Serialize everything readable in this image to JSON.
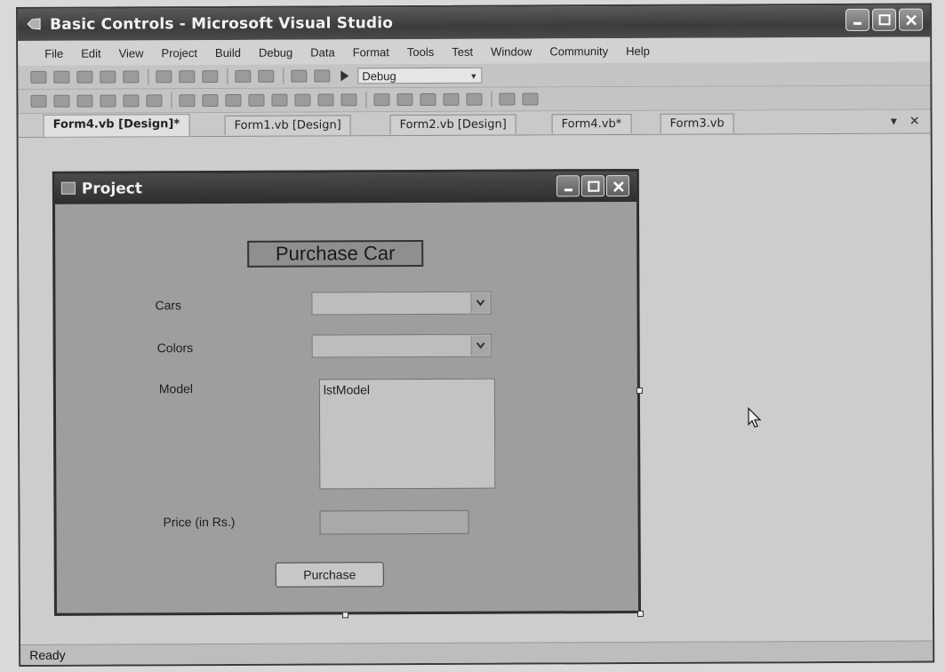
{
  "window": {
    "title": "Basic Controls - Microsoft Visual Studio"
  },
  "menu": [
    "File",
    "Edit",
    "View",
    "Project",
    "Build",
    "Debug",
    "Data",
    "Format",
    "Tools",
    "Test",
    "Window",
    "Community",
    "Help"
  ],
  "toolbar": {
    "configuration": "Debug"
  },
  "tabs": [
    "Form4.vb [Design]*",
    "Form1.vb [Design]",
    "Form2.vb [Design]",
    "Form4.vb*",
    "Form3.vb"
  ],
  "form": {
    "title": "Project",
    "heading": "Purchase Car",
    "cars_label": "Cars",
    "colors_label": "Colors",
    "model_label": "Model",
    "model_list_name": "lstModel",
    "price_label": "Price (in Rs.)",
    "purchase_button": "Purchase"
  },
  "status": {
    "text": "Ready"
  }
}
